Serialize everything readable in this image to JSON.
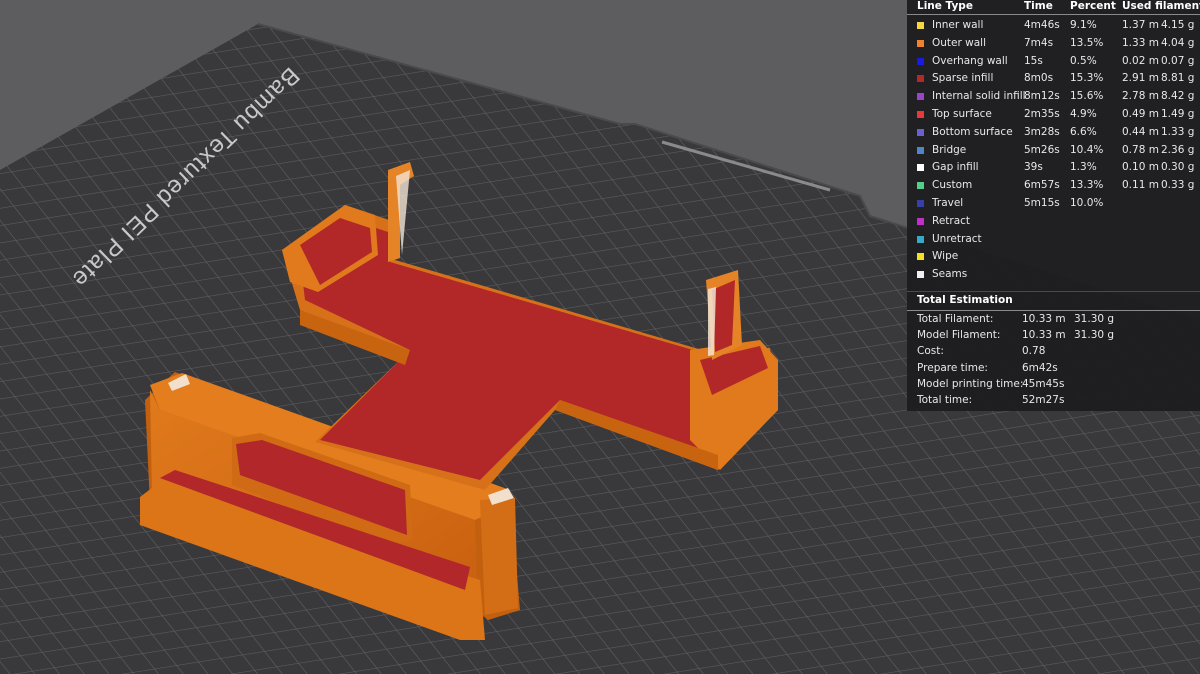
{
  "plate": {
    "label": "Bambu Textured PEI Plate"
  },
  "legend": {
    "headers": {
      "line_type": "Line Type",
      "time": "Time",
      "percent": "Percent",
      "used_filament": "Used filament"
    },
    "rows": [
      {
        "name": "Inner wall",
        "color": "#f5d740",
        "time": "4m46s",
        "percent": "9.1%",
        "length": "1.37 m",
        "weight": "4.15 g"
      },
      {
        "name": "Outer wall",
        "color": "#f0822a",
        "time": "7m4s",
        "percent": "13.5%",
        "length": "1.33 m",
        "weight": "4.04 g"
      },
      {
        "name": "Overhang wall",
        "color": "#1a1ae0",
        "time": "15s",
        "percent": "0.5%",
        "length": "0.02 m",
        "weight": "0.07 g"
      },
      {
        "name": "Sparse infill",
        "color": "#b02a2a",
        "time": "8m0s",
        "percent": "15.3%",
        "length": "2.91 m",
        "weight": "8.81 g"
      },
      {
        "name": "Internal solid infill",
        "color": "#9b43c9",
        "time": "8m12s",
        "percent": "15.6%",
        "length": "2.78 m",
        "weight": "8.42 g"
      },
      {
        "name": "Top surface",
        "color": "#e8383a",
        "time": "2m35s",
        "percent": "4.9%",
        "length": "0.49 m",
        "weight": "1.49 g"
      },
      {
        "name": "Bottom surface",
        "color": "#6c5fd0",
        "time": "3m28s",
        "percent": "6.6%",
        "length": "0.44 m",
        "weight": "1.33 g"
      },
      {
        "name": "Bridge",
        "color": "#4f86c6",
        "time": "5m26s",
        "percent": "10.4%",
        "length": "0.78 m",
        "weight": "2.36 g"
      },
      {
        "name": "Gap infill",
        "color": "#ffffff",
        "time": "39s",
        "percent": "1.3%",
        "length": "0.10 m",
        "weight": "0.30 g"
      },
      {
        "name": "Custom",
        "color": "#52d08a",
        "time": "6m57s",
        "percent": "13.3%",
        "length": "0.11 m",
        "weight": "0.33 g"
      },
      {
        "name": "Travel",
        "color": "#3840a8",
        "time": "5m15s",
        "percent": "10.0%",
        "length": "",
        "weight": ""
      },
      {
        "name": "Retract",
        "color": "#c030c8",
        "time": "",
        "percent": "",
        "length": "",
        "weight": ""
      },
      {
        "name": "Unretract",
        "color": "#38a8c8",
        "time": "",
        "percent": "",
        "length": "",
        "weight": ""
      },
      {
        "name": "Wipe",
        "color": "#f5e020",
        "time": "",
        "percent": "",
        "length": "",
        "weight": ""
      },
      {
        "name": "Seams",
        "color": "#f0f0f0",
        "time": "",
        "percent": "",
        "length": "",
        "weight": ""
      }
    ],
    "total_title": "Total Estimation",
    "totals": [
      {
        "label": "Total Filament:",
        "v1": "10.33 m",
        "v2": "31.30 g"
      },
      {
        "label": "Model Filament:",
        "v1": "10.33 m",
        "v2": "31.30 g"
      },
      {
        "label": "Cost:",
        "v1": "0.78",
        "v2": ""
      },
      {
        "label": "Prepare time:",
        "v1": "6m42s",
        "v2": ""
      },
      {
        "label": "Model printing time:",
        "v1": "45m45s",
        "v2": ""
      },
      {
        "label": "Total time:",
        "v1": "52m27s",
        "v2": ""
      }
    ]
  }
}
